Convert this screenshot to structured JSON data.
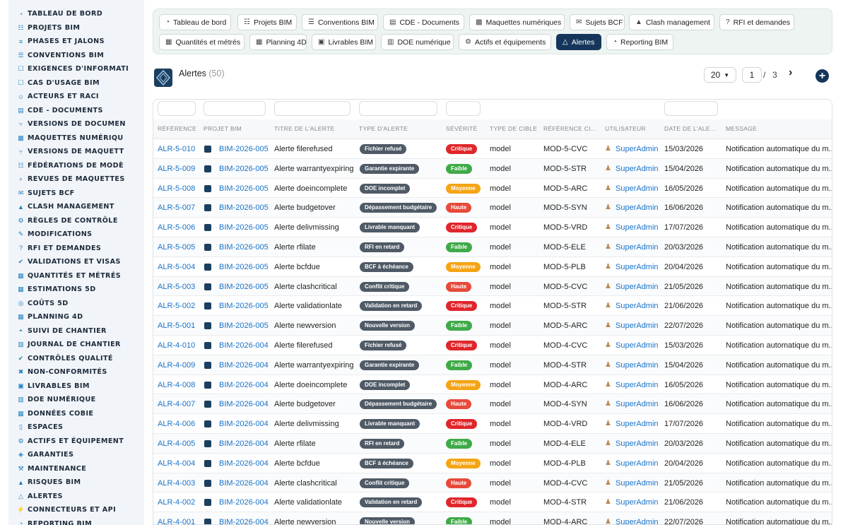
{
  "sidebar": {
    "items": [
      {
        "label": "TABLEAU DE BORD",
        "icon": "dashboard-icon"
      },
      {
        "label": "PROJETS BIM",
        "icon": "project-diagram-icon"
      },
      {
        "label": "PHASES ET JALONS",
        "icon": "layers-icon"
      },
      {
        "label": "CONVENTIONS BIM",
        "icon": "file-contract-icon"
      },
      {
        "label": "EXIGENCES D'INFORMATI",
        "icon": "clipboard-icon"
      },
      {
        "label": "CAS D'USAGE BIM",
        "icon": "clipboard-icon"
      },
      {
        "label": "ACTEURS ET RACI",
        "icon": "users-icon"
      },
      {
        "label": "CDE - DOCUMENTS",
        "icon": "folder-icon"
      },
      {
        "label": "VERSIONS DE DOCUMEN",
        "icon": "branch-icon"
      },
      {
        "label": "MAQUETTES NUMÉRIQU",
        "icon": "cubes-icon"
      },
      {
        "label": "VERSIONS DE MAQUETT",
        "icon": "branch-icon"
      },
      {
        "label": "FÉDÉRATIONS DE MODÈ",
        "icon": "sitemap-icon"
      },
      {
        "label": "REVUES DE MAQUETTES",
        "icon": "search-icon"
      },
      {
        "label": "SUJETS BCF",
        "icon": "comments-icon"
      },
      {
        "label": "CLASH MANAGEMENT",
        "icon": "warning-icon"
      },
      {
        "label": "RÈGLES DE CONTRÔLE",
        "icon": "cogs-icon"
      },
      {
        "label": "MODIFICATIONS",
        "icon": "edit-icon"
      },
      {
        "label": "RFI ET DEMANDES",
        "icon": "question-icon"
      },
      {
        "label": "VALIDATIONS ET VISAS",
        "icon": "check-double-icon"
      },
      {
        "label": "QUANTITÉS ET MÉTRÉS",
        "icon": "calculator-icon"
      },
      {
        "label": "ESTIMATIONS 5D",
        "icon": "calculator-icon"
      },
      {
        "label": "COÛTS 5D",
        "icon": "coins-icon"
      },
      {
        "label": "PLANNING 4D",
        "icon": "calendar-icon"
      },
      {
        "label": "SUIVI DE CHANTIER",
        "icon": "hard-hat-icon"
      },
      {
        "label": "JOURNAL DE CHANTIER",
        "icon": "book-icon"
      },
      {
        "label": "CONTRÔLES QUALITÉ",
        "icon": "check-circle-icon"
      },
      {
        "label": "NON-CONFORMITÉS",
        "icon": "times-circle-icon"
      },
      {
        "label": "LIVRABLES BIM",
        "icon": "box-icon"
      },
      {
        "label": "DOE NUMÉRIQUE",
        "icon": "book-open-icon"
      },
      {
        "label": "DONNÉES COBIE",
        "icon": "table-icon"
      },
      {
        "label": "ESPACES",
        "icon": "door-icon"
      },
      {
        "label": "ACTIFS ET ÉQUIPEMENT",
        "icon": "cogs-icon"
      },
      {
        "label": "GARANTIES",
        "icon": "shield-icon"
      },
      {
        "label": "MAINTENANCE",
        "icon": "wrench-icon"
      },
      {
        "label": "RISQUES BIM",
        "icon": "warning-icon"
      },
      {
        "label": "ALERTES",
        "icon": "bell-icon"
      },
      {
        "label": "CONNECTEURS ET API",
        "icon": "plug-icon"
      },
      {
        "label": "REPORTING BIM",
        "icon": "chart-pie-icon"
      }
    ]
  },
  "tabs": [
    {
      "label": "Tableau de bord",
      "icon": "dashboard-icon",
      "active": false
    },
    {
      "label": "Projets BIM",
      "icon": "project-diagram-icon",
      "active": false
    },
    {
      "label": "Conventions BIM",
      "icon": "file-contract-icon",
      "active": false
    },
    {
      "label": "CDE - Documents",
      "icon": "folder-icon",
      "active": false
    },
    {
      "label": "Maquettes numériques",
      "icon": "cubes-icon",
      "active": false
    },
    {
      "label": "Sujets BCF",
      "icon": "comments-icon",
      "active": false
    },
    {
      "label": "Clash management",
      "icon": "warning-icon",
      "active": false
    },
    {
      "label": "RFI et demandes",
      "icon": "question-icon",
      "active": false
    },
    {
      "label": "Quantités et métrés",
      "icon": "calculator-icon",
      "active": false
    },
    {
      "label": "Planning 4D",
      "icon": "calendar-icon",
      "active": false
    },
    {
      "label": "Livrables BIM",
      "icon": "box-icon",
      "active": false
    },
    {
      "label": "DOE numérique",
      "icon": "book-open-icon",
      "active": false
    },
    {
      "label": "Actifs et équipements",
      "icon": "cogs-icon",
      "active": false
    },
    {
      "label": "Alertes",
      "icon": "bell-icon",
      "active": true
    },
    {
      "label": "Reporting BIM",
      "icon": "chart-pie-icon",
      "active": false
    }
  ],
  "header": {
    "title": "Alertes",
    "count": "(50)",
    "page_size": "20",
    "page_current": "1",
    "page_separator": "/",
    "page_total": "3"
  },
  "table": {
    "columns": [
      "RÉFÉRENCE",
      "PROJET BIM",
      "TITRE DE L'ALERTE",
      "TYPE D'ALERTE",
      "SÉVÉRITÉ",
      "TYPE DE CIBLE",
      "RÉFÉRENCE CI...",
      "UTILISATEUR",
      "DATE DE L'ALE...",
      "MESSAGE"
    ],
    "rows": [
      {
        "ref": "ALR-5-010",
        "projet": "BIM-2026-005",
        "titre": "Alerte filerefused",
        "type": "Fichier refusé",
        "severite": "Critique",
        "cible": "model",
        "refcible": "MOD-5-CVC",
        "user": "SuperAdmin",
        "date": "15/03/2026",
        "message": "Notification automatique du m..."
      },
      {
        "ref": "ALR-5-009",
        "projet": "BIM-2026-005",
        "titre": "Alerte warrantyexpiring",
        "type": "Garantie expirante",
        "severite": "Faible",
        "cible": "model",
        "refcible": "MOD-5-STR",
        "user": "SuperAdmin",
        "date": "15/04/2026",
        "message": "Notification automatique du m..."
      },
      {
        "ref": "ALR-5-008",
        "projet": "BIM-2026-005",
        "titre": "Alerte doeincomplete",
        "type": "DOE incomplet",
        "severite": "Moyenne",
        "cible": "model",
        "refcible": "MOD-5-ARC",
        "user": "SuperAdmin",
        "date": "16/05/2026",
        "message": "Notification automatique du m..."
      },
      {
        "ref": "ALR-5-007",
        "projet": "BIM-2026-005",
        "titre": "Alerte budgetover",
        "type": "Dépassement budgétaire",
        "severite": "Haute",
        "cible": "model",
        "refcible": "MOD-5-SYN",
        "user": "SuperAdmin",
        "date": "16/06/2026",
        "message": "Notification automatique du m..."
      },
      {
        "ref": "ALR-5-006",
        "projet": "BIM-2026-005",
        "titre": "Alerte delivmissing",
        "type": "Livrable manquant",
        "severite": "Critique",
        "cible": "model",
        "refcible": "MOD-5-VRD",
        "user": "SuperAdmin",
        "date": "17/07/2026",
        "message": "Notification automatique du m..."
      },
      {
        "ref": "ALR-5-005",
        "projet": "BIM-2026-005",
        "titre": "Alerte rfilate",
        "type": "RFI en retard",
        "severite": "Faible",
        "cible": "model",
        "refcible": "MOD-5-ELE",
        "user": "SuperAdmin",
        "date": "20/03/2026",
        "message": "Notification automatique du m..."
      },
      {
        "ref": "ALR-5-004",
        "projet": "BIM-2026-005",
        "titre": "Alerte bcfdue",
        "type": "BCF à échéance",
        "severite": "Moyenne",
        "cible": "model",
        "refcible": "MOD-5-PLB",
        "user": "SuperAdmin",
        "date": "20/04/2026",
        "message": "Notification automatique du m..."
      },
      {
        "ref": "ALR-5-003",
        "projet": "BIM-2026-005",
        "titre": "Alerte clashcritical",
        "type": "Conflit critique",
        "severite": "Haute",
        "cible": "model",
        "refcible": "MOD-5-CVC",
        "user": "SuperAdmin",
        "date": "21/05/2026",
        "message": "Notification automatique du m..."
      },
      {
        "ref": "ALR-5-002",
        "projet": "BIM-2026-005",
        "titre": "Alerte validationlate",
        "type": "Validation en retard",
        "severite": "Critique",
        "cible": "model",
        "refcible": "MOD-5-STR",
        "user": "SuperAdmin",
        "date": "21/06/2026",
        "message": "Notification automatique du m..."
      },
      {
        "ref": "ALR-5-001",
        "projet": "BIM-2026-005",
        "titre": "Alerte newversion",
        "type": "Nouvelle version",
        "severite": "Faible",
        "cible": "model",
        "refcible": "MOD-5-ARC",
        "user": "SuperAdmin",
        "date": "22/07/2026",
        "message": "Notification automatique du m..."
      },
      {
        "ref": "ALR-4-010",
        "projet": "BIM-2026-004",
        "titre": "Alerte filerefused",
        "type": "Fichier refusé",
        "severite": "Critique",
        "cible": "model",
        "refcible": "MOD-4-CVC",
        "user": "SuperAdmin",
        "date": "15/03/2026",
        "message": "Notification automatique du m..."
      },
      {
        "ref": "ALR-4-009",
        "projet": "BIM-2026-004",
        "titre": "Alerte warrantyexpiring",
        "type": "Garantie expirante",
        "severite": "Faible",
        "cible": "model",
        "refcible": "MOD-4-STR",
        "user": "SuperAdmin",
        "date": "15/04/2026",
        "message": "Notification automatique du m..."
      },
      {
        "ref": "ALR-4-008",
        "projet": "BIM-2026-004",
        "titre": "Alerte doeincomplete",
        "type": "DOE incomplet",
        "severite": "Moyenne",
        "cible": "model",
        "refcible": "MOD-4-ARC",
        "user": "SuperAdmin",
        "date": "16/05/2026",
        "message": "Notification automatique du m..."
      },
      {
        "ref": "ALR-4-007",
        "projet": "BIM-2026-004",
        "titre": "Alerte budgetover",
        "type": "Dépassement budgétaire",
        "severite": "Haute",
        "cible": "model",
        "refcible": "MOD-4-SYN",
        "user": "SuperAdmin",
        "date": "16/06/2026",
        "message": "Notification automatique du m..."
      },
      {
        "ref": "ALR-4-006",
        "projet": "BIM-2026-004",
        "titre": "Alerte delivmissing",
        "type": "Livrable manquant",
        "severite": "Critique",
        "cible": "model",
        "refcible": "MOD-4-VRD",
        "user": "SuperAdmin",
        "date": "17/07/2026",
        "message": "Notification automatique du m..."
      },
      {
        "ref": "ALR-4-005",
        "projet": "BIM-2026-004",
        "titre": "Alerte rfilate",
        "type": "RFI en retard",
        "severite": "Faible",
        "cible": "model",
        "refcible": "MOD-4-ELE",
        "user": "SuperAdmin",
        "date": "20/03/2026",
        "message": "Notification automatique du m..."
      },
      {
        "ref": "ALR-4-004",
        "projet": "BIM-2026-004",
        "titre": "Alerte bcfdue",
        "type": "BCF à échéance",
        "severite": "Moyenne",
        "cible": "model",
        "refcible": "MOD-4-PLB",
        "user": "SuperAdmin",
        "date": "20/04/2026",
        "message": "Notification automatique du m..."
      },
      {
        "ref": "ALR-4-003",
        "projet": "BIM-2026-004",
        "titre": "Alerte clashcritical",
        "type": "Conflit critique",
        "severite": "Haute",
        "cible": "model",
        "refcible": "MOD-4-CVC",
        "user": "SuperAdmin",
        "date": "21/05/2026",
        "message": "Notification automatique du m..."
      },
      {
        "ref": "ALR-4-002",
        "projet": "BIM-2026-004",
        "titre": "Alerte validationlate",
        "type": "Validation en retard",
        "severite": "Critique",
        "cible": "model",
        "refcible": "MOD-4-STR",
        "user": "SuperAdmin",
        "date": "21/06/2026",
        "message": "Notification automatique du m..."
      },
      {
        "ref": "ALR-4-001",
        "projet": "BIM-2026-004",
        "titre": "Alerte newversion",
        "type": "Nouvelle version",
        "severite": "Faible",
        "cible": "model",
        "refcible": "MOD-4-ARC",
        "user": "SuperAdmin",
        "date": "22/07/2026",
        "message": "Notification automatique du m..."
      }
    ]
  },
  "colors": {
    "accent": "#15365a",
    "link": "#1a73c8",
    "critique": "#e0262b",
    "faible": "#3faa48",
    "moyenne": "#f5a414",
    "haute": "#e64a3a",
    "type_badge": "#4f5a66"
  }
}
